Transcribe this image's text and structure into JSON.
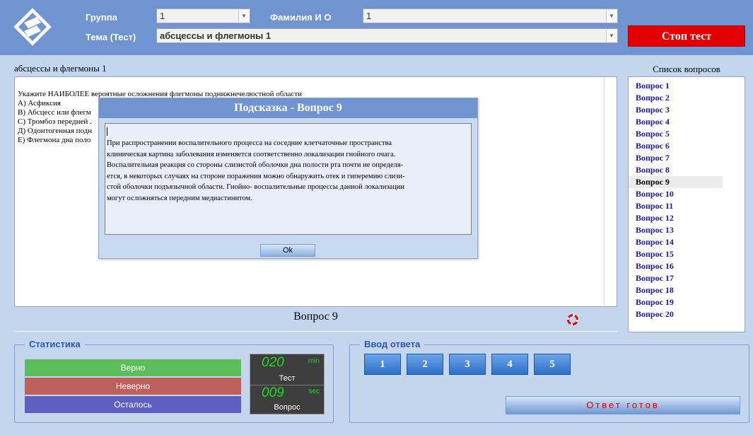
{
  "header": {
    "group_label": "Группа",
    "group_value": "1",
    "name_label": "Фамилия И О",
    "name_value": "1",
    "topic_label": "Тема (Тест)",
    "topic_value": "абсцессы и флегмоны 1",
    "stop_label": "Стоп тест"
  },
  "test": {
    "title": "абсцессы и флегмоны 1",
    "question_lines": [
      "Укажите НАИБОЛЕЕ вероятные осложнения флегмоны поднижнечелюстной области",
      "А) Асфиксия",
      "В) Абсцесс или флегм",
      "С) Тромбоз передней .",
      "Д) Одонтогенная подн",
      "Е) Флегмона дна поло"
    ],
    "current_question": "Вопрос 9"
  },
  "question_list": {
    "title": "Список вопросов",
    "items": [
      "Вопрос 1",
      "Вопрос 2",
      "Вопрос 3",
      "Вопрос 4",
      "Вопрос 5",
      "Вопрос 6",
      "Вопрос 7",
      "Вопрос 8",
      "Вопрос 9",
      "Вопрос 10",
      "Вопрос 11",
      "Вопрос 12",
      "Вопрос 13",
      "Вопрос 14",
      "Вопрос 15",
      "Вопрос 16",
      "Вопрос 17",
      "Вопрос 18",
      "Вопрос 19",
      "Вопрос 20"
    ],
    "selected_index": 8
  },
  "stats": {
    "title": "Статистика",
    "correct_label": "Верно",
    "wrong_label": "Неверно",
    "remaining_label": "Осталось",
    "timer_test_value": "020",
    "timer_test_unit": "min",
    "timer_test_caption": "Тест",
    "timer_question_value": "009",
    "timer_question_unit": "sec",
    "timer_question_caption": "Вопрос"
  },
  "answer": {
    "title": "Ввод ответа",
    "buttons": [
      "1",
      "2",
      "3",
      "4",
      "5"
    ],
    "ready_label": "Ответ готов"
  },
  "hint_dialog": {
    "title": "Подсказка -  Вопрос 9",
    "text_lines": [
      "При распространении воспалительного процесса на соседние клетчаточные пространства",
      "клиническая картина заболевания изменяется соответственно локализации гнойного очага.",
      "Воспалительная реакция со стороны слизистой оболочки дна полости рта почти не определя-",
      "ется, в некоторых случаях на стороне поражения можно обнаружить отек и гиперемию слизи-",
      "стой оболочки подъязычной области. Гнойно- воспалительные процессы данной локализации",
      "могут осложняться передним медиастинитом."
    ],
    "ok_label": "Ok"
  },
  "colors": {
    "header_bg": "#6f94cf",
    "page_bg": "#c4d5ee",
    "stop_red": "#e30000",
    "correct_green": "#5dbd5d",
    "wrong_red": "#c0605c",
    "remaining_blue": "#5f5fc0",
    "timer_green": "#22d822"
  }
}
